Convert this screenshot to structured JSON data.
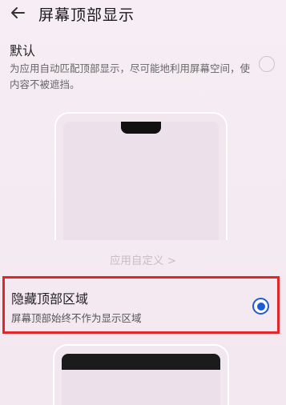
{
  "header": {
    "title": "屏幕顶部显示",
    "back_icon": "arrow-left-icon"
  },
  "options": {
    "default": {
      "label": "默认",
      "description": "为应用自动匹配顶部显示，尽可能地利用屏幕空间，使内容不被遮挡。",
      "selected": false
    },
    "customize_link": "应用自定义 >",
    "hide_top": {
      "label": "隐藏顶部区域",
      "description": "屏幕顶部始终不作为显示区域",
      "selected": true
    }
  },
  "colors": {
    "accent": "#1f5bd6",
    "highlight_box": "#e2262a"
  }
}
